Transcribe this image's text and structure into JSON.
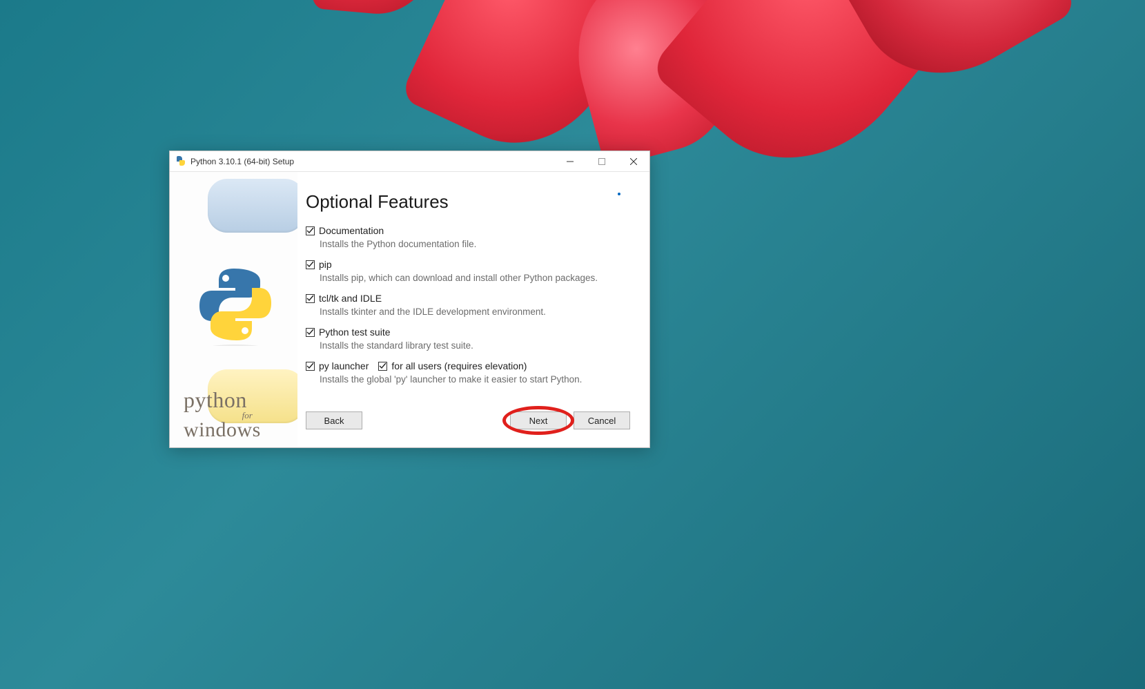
{
  "window": {
    "title": "Python 3.10.1 (64-bit) Setup"
  },
  "sidebar": {
    "brand_line1": "python",
    "brand_line2": "for",
    "brand_line3": "windows"
  },
  "main": {
    "heading": "Optional Features",
    "features": [
      {
        "label": "Documentation",
        "desc": "Installs the Python documentation file.",
        "checked": true
      },
      {
        "label": "pip",
        "desc": "Installs pip, which can download and install other Python packages.",
        "checked": true
      },
      {
        "label": "tcl/tk and IDLE",
        "desc": "Installs tkinter and the IDLE development environment.",
        "checked": true
      },
      {
        "label": "Python test suite",
        "desc": "Installs the standard library test suite.",
        "checked": true
      }
    ],
    "launcher": {
      "label1": "py launcher",
      "label2": "for all users (requires elevation)",
      "desc": "Installs the global 'py' launcher to make it easier to start Python.",
      "checked1": true,
      "checked2": true
    }
  },
  "buttons": {
    "back": "Back",
    "next": "Next",
    "cancel": "Cancel"
  }
}
